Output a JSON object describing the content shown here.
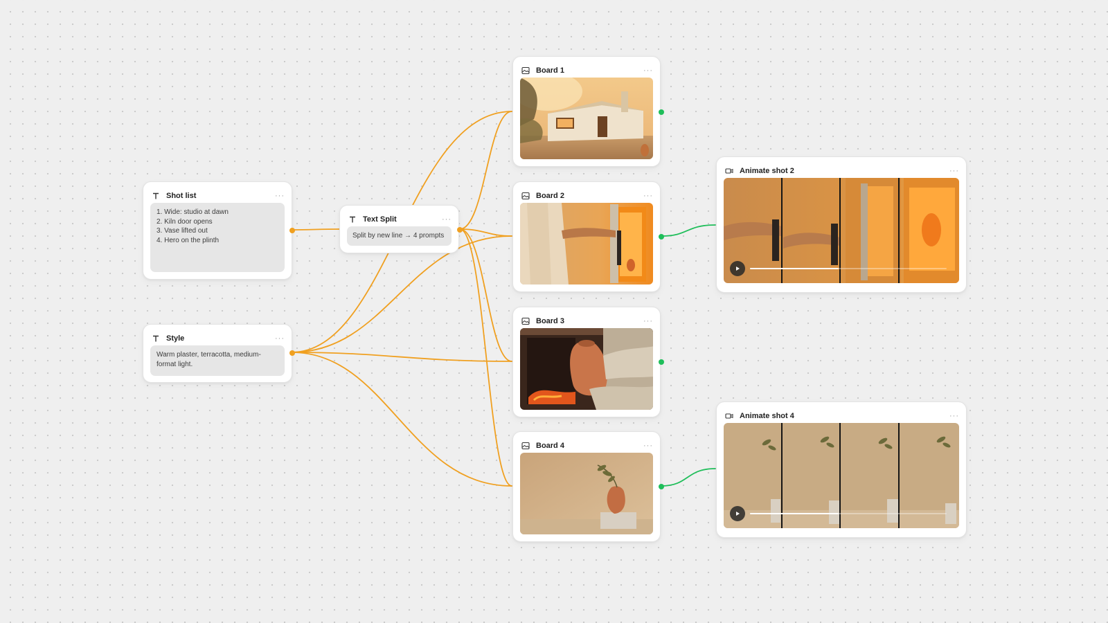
{
  "colors": {
    "canvas": "#efefef",
    "wire_text": "#f0a020",
    "wire_video": "#1fbe5a",
    "node_bg": "#ffffff",
    "text_box_bg": "#e6e6e6"
  },
  "nodes": {
    "shot_list": {
      "title": "Shot list",
      "icon": "text-icon",
      "lines": [
        "1. Wide: studio at dawn",
        "2. Kiln door opens",
        "3. Vase lifted out",
        "4. Hero on the plinth"
      ]
    },
    "style": {
      "title": "Style",
      "icon": "text-icon",
      "text": "Warm plaster, terracotta, medium-format light."
    },
    "text_split": {
      "title": "Text Split",
      "icon": "text-icon",
      "text": "Split by new line → 4 prompts"
    },
    "board1": {
      "title": "Board 1",
      "icon": "image-icon",
      "image": "sunlit white plaster studio house with olive tree at dawn"
    },
    "board2": {
      "title": "Board 2",
      "icon": "image-icon",
      "image": "person in apron opening a glowing kiln door"
    },
    "board3": {
      "title": "Board 3",
      "icon": "image-icon",
      "image": "hands lifting a terracotta vase out of the kiln"
    },
    "board4": {
      "title": "Board 4",
      "icon": "image-icon",
      "image": "terracotta vase with olive sprig on a stone plinth"
    },
    "animate2": {
      "title": "Animate shot 2",
      "icon": "video-icon",
      "progress": 0.45
    },
    "animate4": {
      "title": "Animate shot 4",
      "icon": "video-icon",
      "progress": 0.45
    }
  }
}
